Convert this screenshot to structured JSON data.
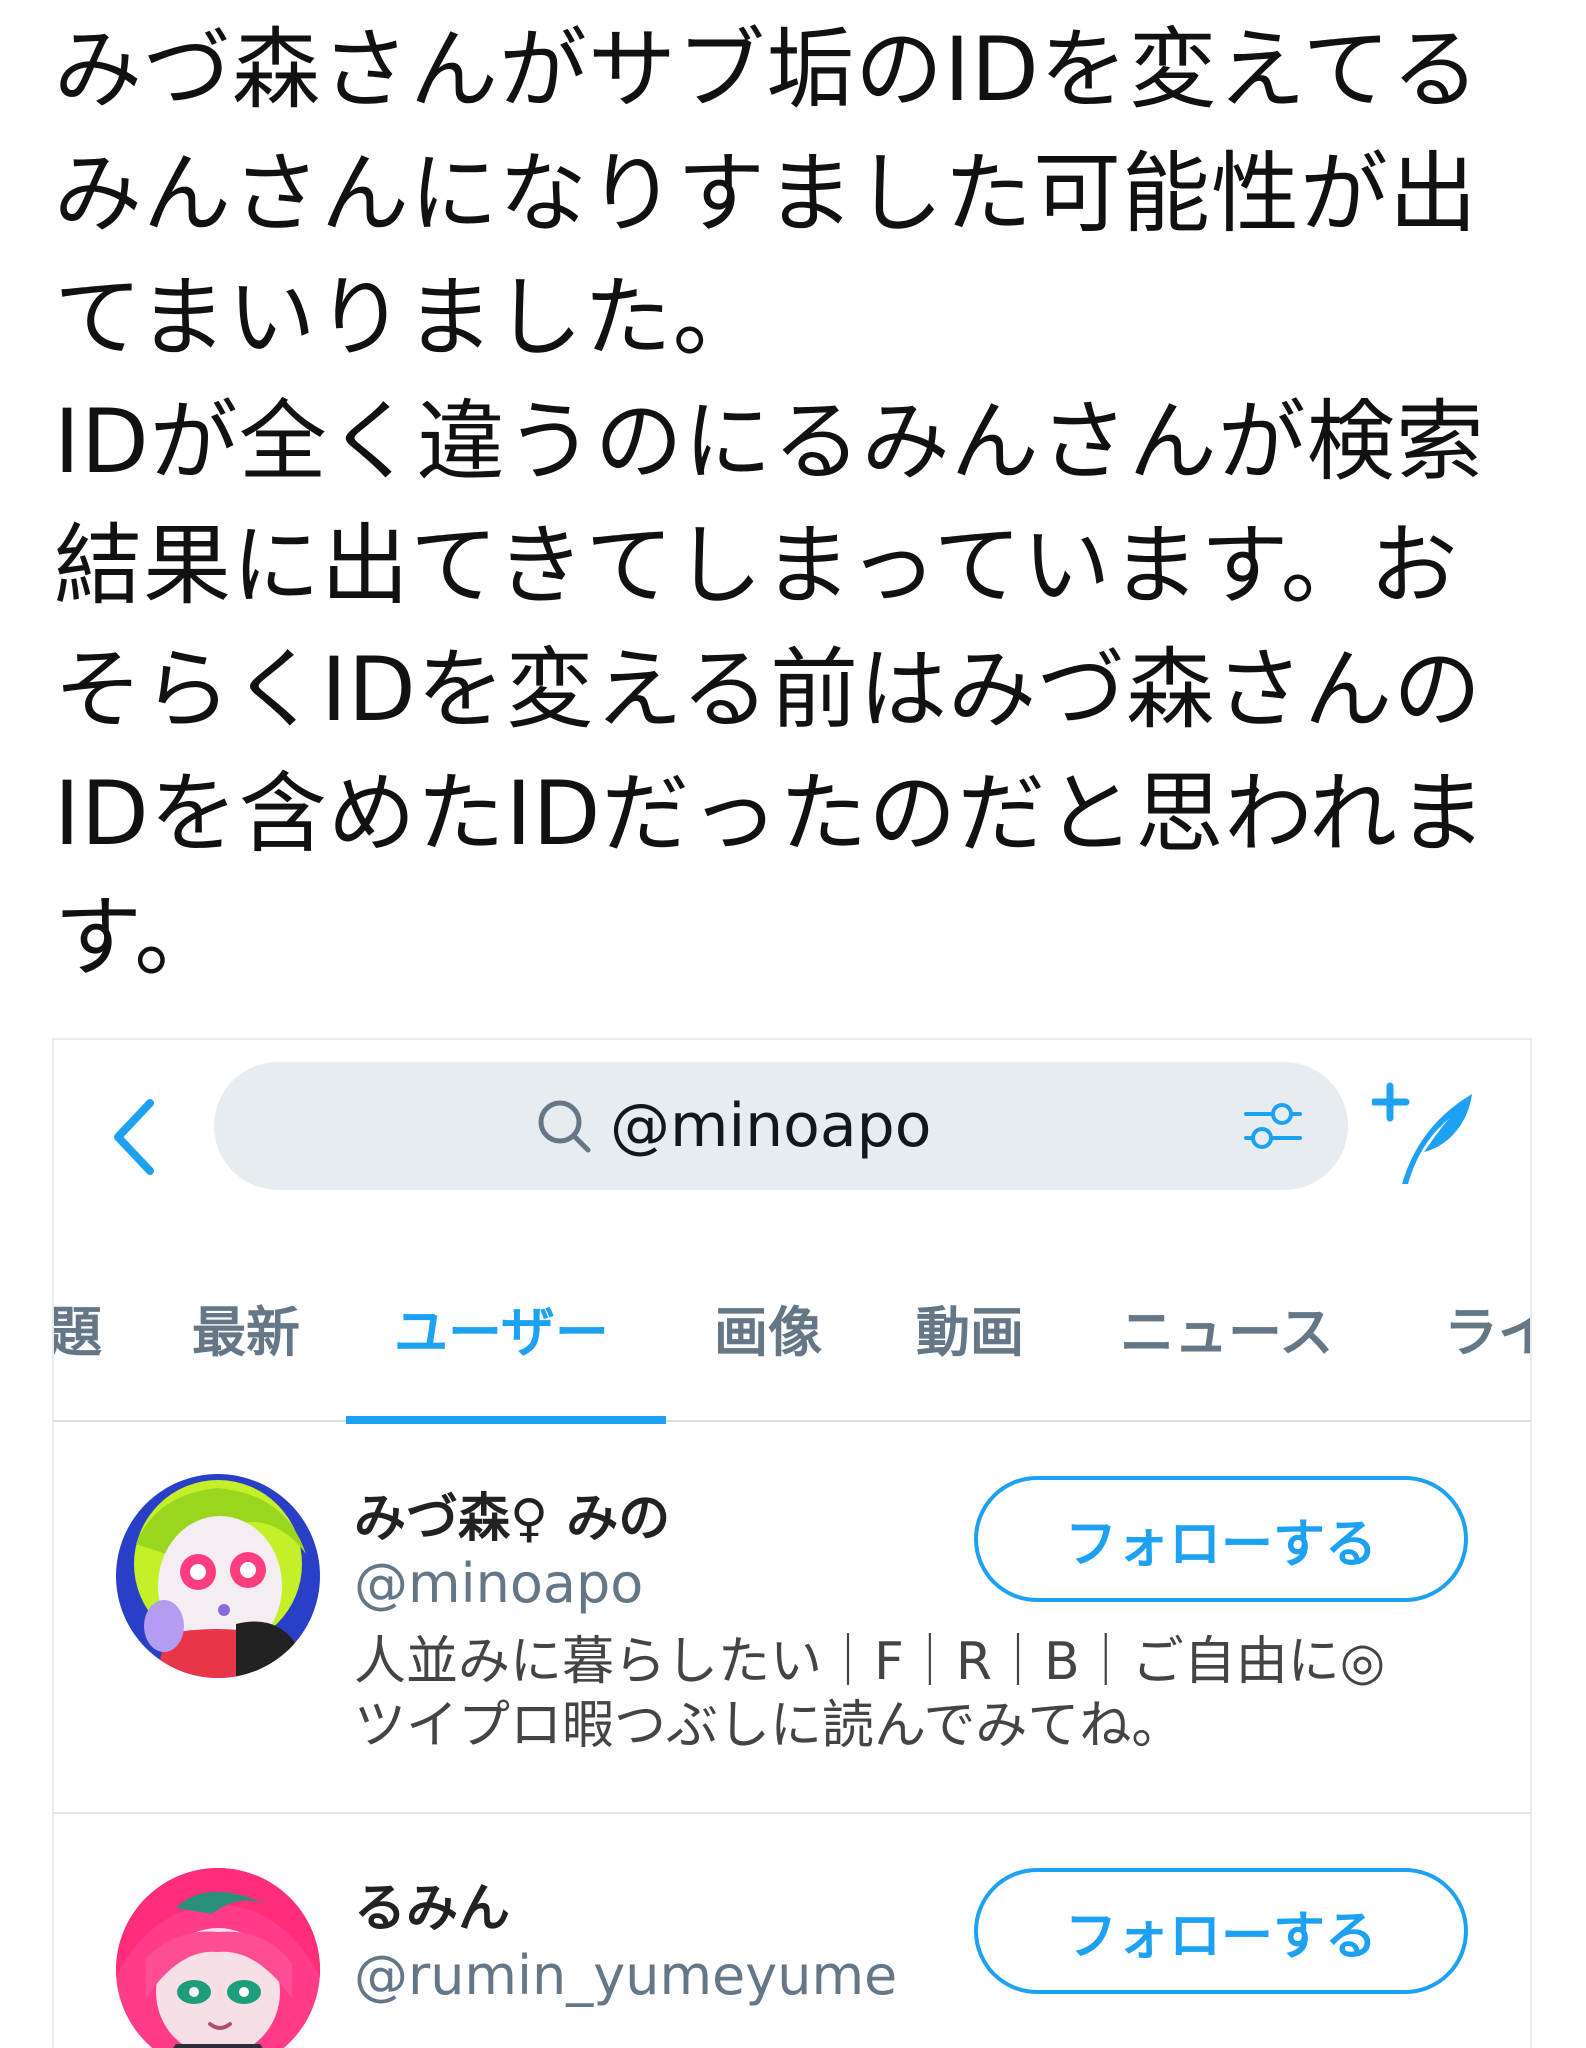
{
  "tweet": {
    "text": "みづ森さんがサブ垢のIDを変えてるみんさんになりすました可能性が出てまいりました。\nIDが全く違うのにるみんさんが検索結果に出てきてしまっています。おそらくIDを変える前はみづ森さんのIDを含めたIDだったのだと思われます。"
  },
  "search": {
    "query": "@minoapo",
    "icons": [
      "back-chevron-icon",
      "search-icon",
      "filter-sliders-icon",
      "compose-tweet-icon"
    ],
    "accent_color": "#1da1f2"
  },
  "tabs": [
    {
      "label": "題"
    },
    {
      "label": "最新"
    },
    {
      "label": "ユーザー",
      "active": true
    },
    {
      "label": "画像"
    },
    {
      "label": "動画"
    },
    {
      "label": "ニュース"
    },
    {
      "label": "ライ"
    }
  ],
  "users": [
    {
      "name": "みづ森♀ みの",
      "handle": "@minoapo",
      "bio": "人並みに暮らしたい｜F｜R｜B｜ご自由に◎\nツイプロ暇つぶしに読んでみてね。",
      "follow_label": "フォローする"
    },
    {
      "name": "るみん",
      "handle": "@rumin_yumeyume",
      "bio": "",
      "follow_label": "フォローする"
    }
  ]
}
